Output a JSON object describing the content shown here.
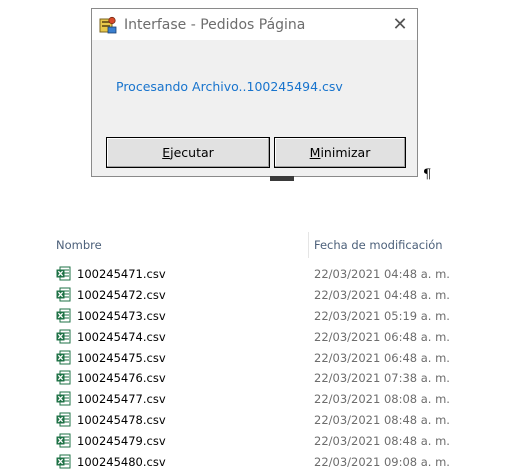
{
  "dialog": {
    "title": "Interfase - Pedidos Página",
    "close_glyph": "✕",
    "status_text": "Procesando Archivo..100245494.csv",
    "buttons": {
      "ejecutar": {
        "first": "E",
        "rest": "jecutar"
      },
      "minimizar": {
        "first": "M",
        "rest": "inimizar"
      }
    },
    "app_icon": "app-icon"
  },
  "pilcrow": "¶",
  "file_list": {
    "columns": {
      "name": "Nombre",
      "date": "Fecha de modificación"
    },
    "file_icon": "excel-csv-icon",
    "files": [
      {
        "name": "100245471.csv",
        "date": "22/03/2021 04:48 a. m."
      },
      {
        "name": "100245472.csv",
        "date": "22/03/2021 04:48 a. m."
      },
      {
        "name": "100245473.csv",
        "date": "22/03/2021 05:19 a. m."
      },
      {
        "name": "100245474.csv",
        "date": "22/03/2021 06:48 a. m."
      },
      {
        "name": "100245475.csv",
        "date": "22/03/2021 06:48 a. m."
      },
      {
        "name": "100245476.csv",
        "date": "22/03/2021 07:38 a. m."
      },
      {
        "name": "100245477.csv",
        "date": "22/03/2021 08:08 a. m."
      },
      {
        "name": "100245478.csv",
        "date": "22/03/2021 08:48 a. m."
      },
      {
        "name": "100245479.csv",
        "date": "22/03/2021 08:48 a. m."
      },
      {
        "name": "100245480.csv",
        "date": "22/03/2021 09:08 a. m."
      }
    ]
  },
  "colors": {
    "status_text": "#1874cd",
    "header_text": "#4c607a",
    "excel_green": "#1e7145"
  }
}
